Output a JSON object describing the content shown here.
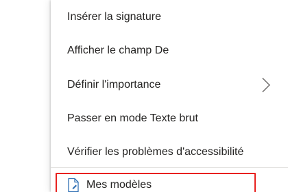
{
  "menu": {
    "items": [
      {
        "label": "Insérer la signature"
      },
      {
        "label": "Afficher le champ De"
      },
      {
        "label": "Définir l'importance"
      },
      {
        "label": "Passer en mode Texte brut"
      },
      {
        "label": "Vérifier les problèmes d'accessibilité"
      }
    ],
    "templates": {
      "label": "Mes modèles",
      "icon": "document-template-icon",
      "highlight_color": "#e8211f"
    }
  }
}
